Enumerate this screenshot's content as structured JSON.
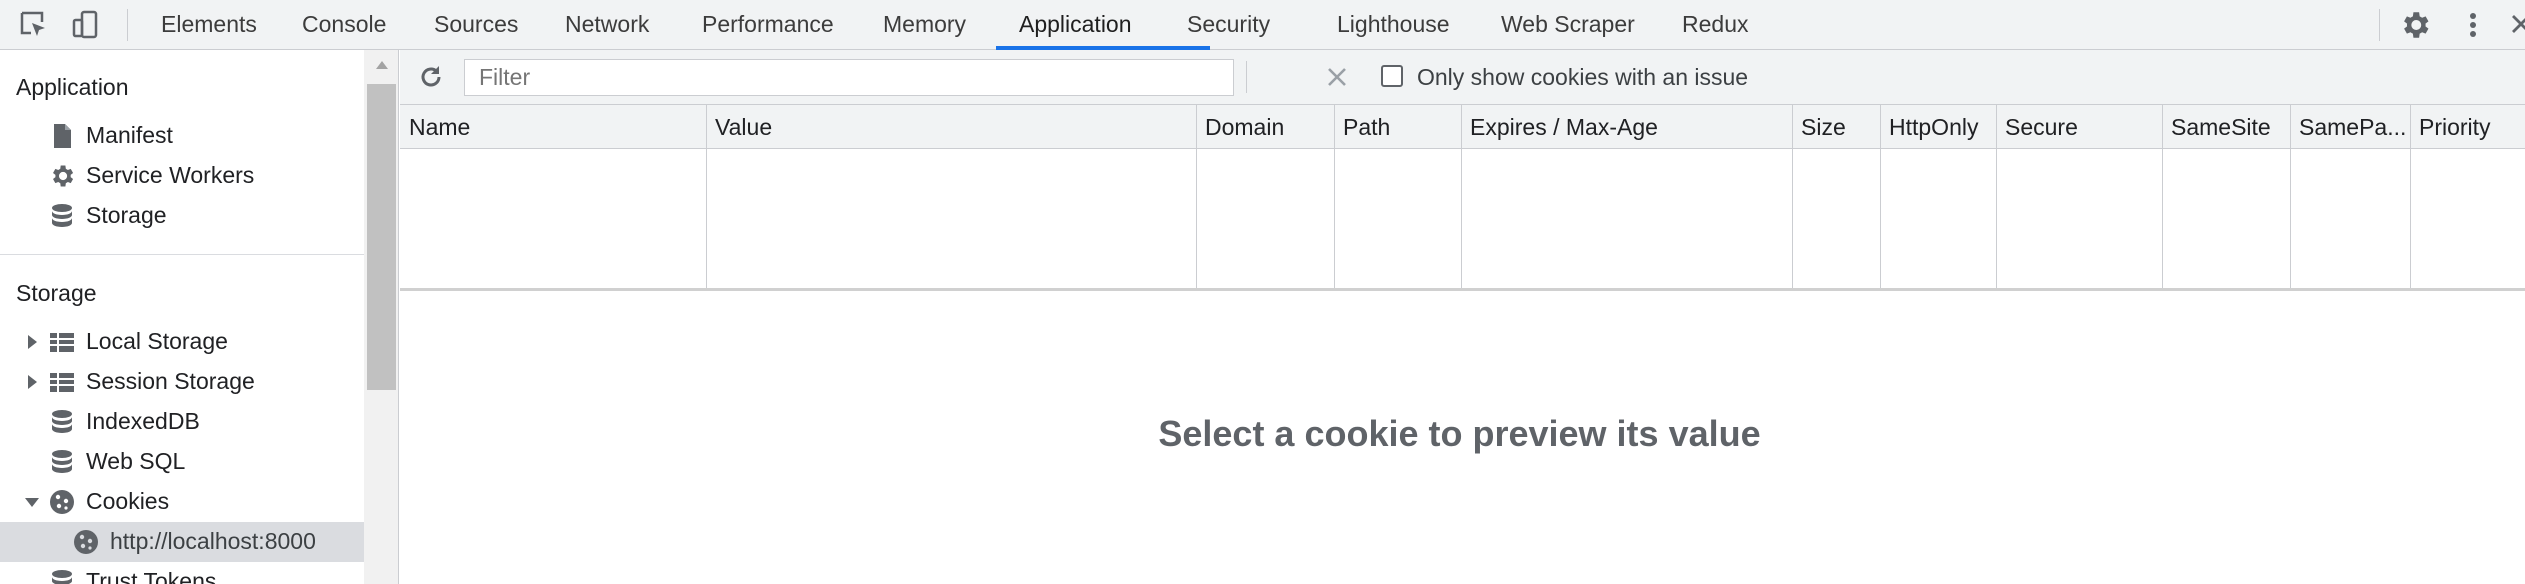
{
  "tabs": [
    "Elements",
    "Console",
    "Sources",
    "Network",
    "Performance",
    "Memory",
    "Application",
    "Security",
    "Lighthouse",
    "Web Scraper",
    "Redux"
  ],
  "active_tab": "Application",
  "toolbar_icons": [
    "inspect-element-icon",
    "device-toggle-icon",
    "settings-gear-icon",
    "more-vertical-icon",
    "close-icon"
  ],
  "sidebar": {
    "application_header": "Application",
    "application_items": [
      {
        "label": "Manifest",
        "icon": "file-icon"
      },
      {
        "label": "Service Workers",
        "icon": "gear-icon"
      },
      {
        "label": "Storage",
        "icon": "database-icon"
      }
    ],
    "storage_header": "Storage",
    "storage_items": [
      {
        "label": "Local Storage",
        "icon": "table-icon",
        "expanded": false
      },
      {
        "label": "Session Storage",
        "icon": "table-icon",
        "expanded": false
      },
      {
        "label": "IndexedDB",
        "icon": "database-icon"
      },
      {
        "label": "Web SQL",
        "icon": "database-icon"
      },
      {
        "label": "Cookies",
        "icon": "cookie-icon",
        "expanded": true
      },
      {
        "label": "http://localhost:8000",
        "icon": "cookie-icon",
        "selected": true
      },
      {
        "label": "Trust Tokens",
        "icon": "database-icon"
      }
    ]
  },
  "cookies_toolbar": {
    "filter_placeholder": "Filter",
    "only_issues_label": "Only show cookies with an issue",
    "only_issues_checked": false
  },
  "cookie_table": {
    "columns": [
      "Name",
      "Value",
      "Domain",
      "Path",
      "Expires / Max-Age",
      "Size",
      "HttpOnly",
      "Secure",
      "SameSite",
      "SamePa...",
      "Priority"
    ],
    "rows": []
  },
  "preview_message": "Select a cookie to preview its value",
  "colors": {
    "accent": "#1a73e8",
    "panel_bg": "#f1f3f4",
    "border": "#cbcdd1",
    "selected_row": "#dadce0"
  }
}
